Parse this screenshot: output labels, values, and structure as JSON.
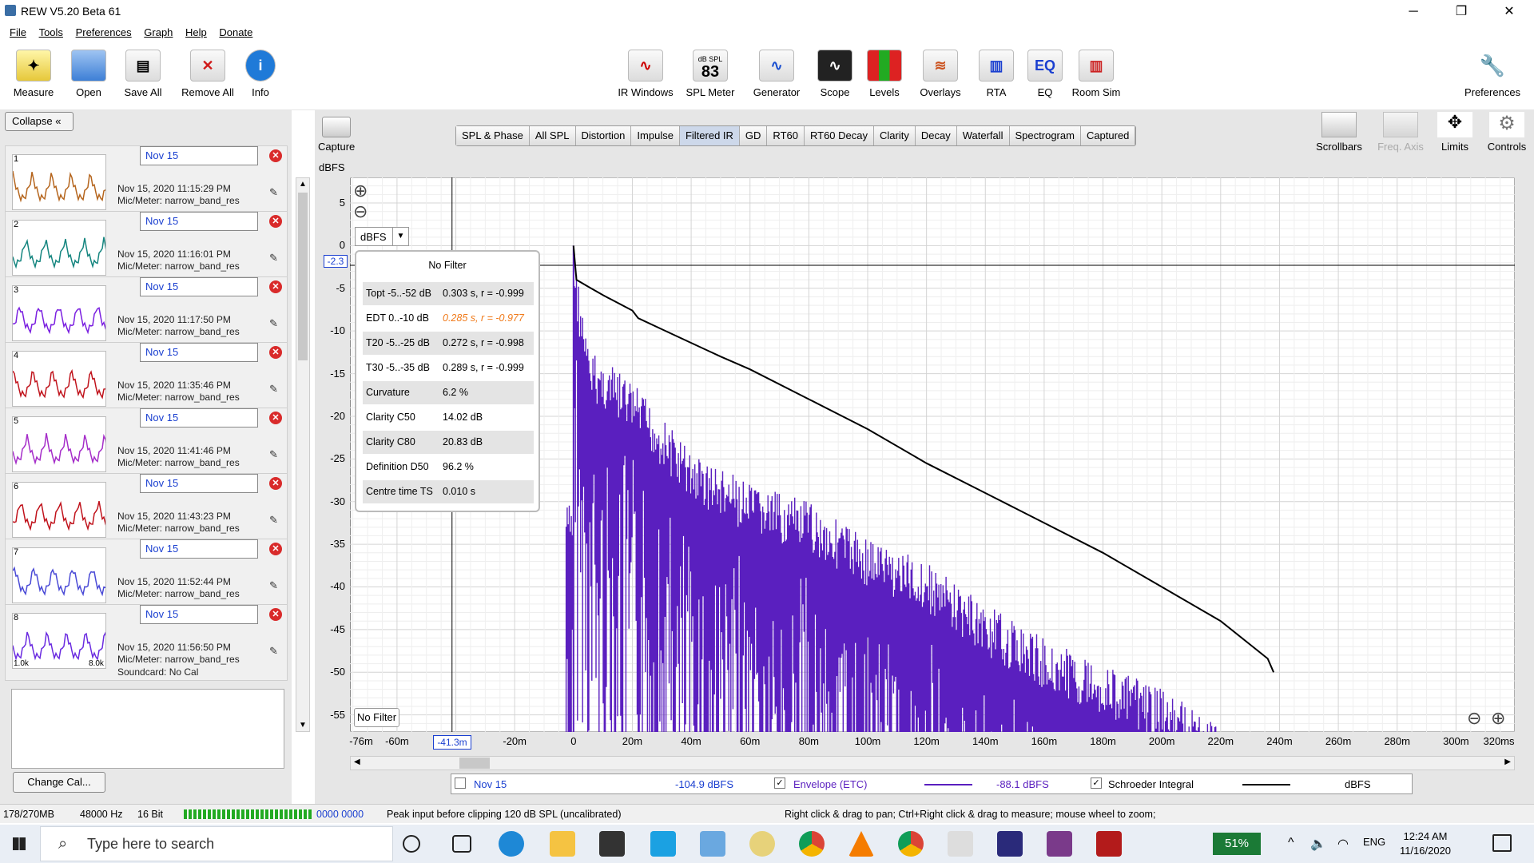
{
  "window": {
    "title": "REW V5.20 Beta 61",
    "minimize": "─",
    "restore": "❐",
    "close": "✕"
  },
  "menu": [
    "File",
    "Tools",
    "Preferences",
    "Graph",
    "Help",
    "Donate"
  ],
  "toolbar": {
    "left": [
      {
        "label": "Measure",
        "icon": "measure-icon"
      },
      {
        "label": "Open",
        "icon": "folder-icon"
      },
      {
        "label": "Save All",
        "icon": "save-icon"
      },
      {
        "label": "Remove All",
        "icon": "remove-all-icon"
      },
      {
        "label": "Info",
        "icon": "info-icon"
      }
    ],
    "center": [
      {
        "label": "IR Windows",
        "icon": "ir-windows-icon"
      },
      {
        "label": "SPL Meter",
        "icon": "spl-meter-icon",
        "badge_top": "dB SPL",
        "badge_value": "83"
      },
      {
        "label": "Generator",
        "icon": "generator-icon"
      },
      {
        "label": "Scope",
        "icon": "scope-icon"
      },
      {
        "label": "Levels",
        "icon": "levels-icon"
      },
      {
        "label": "Overlays",
        "icon": "overlays-icon"
      },
      {
        "label": "RTA",
        "icon": "rta-icon"
      },
      {
        "label": "EQ",
        "icon": "eq-icon"
      },
      {
        "label": "Room Sim",
        "icon": "room-sim-icon"
      }
    ],
    "preferences": "Preferences"
  },
  "left_panel": {
    "collapse": "Collapse",
    "change_cal": "Change Cal...",
    "measurements": [
      {
        "num": "1",
        "name": "Nov 15",
        "date": "Nov 15, 2020 11:15:29 PM",
        "mic": "Mic/Meter: narrow_band_res",
        "color": "#b5651d"
      },
      {
        "num": "2",
        "name": "Nov 15",
        "date": "Nov 15, 2020 11:16:01 PM",
        "mic": "Mic/Meter: narrow_band_res",
        "color": "#14857f"
      },
      {
        "num": "3",
        "name": "Nov 15",
        "date": "Nov 15, 2020 11:17:50 PM",
        "mic": "Mic/Meter: narrow_band_res",
        "color": "#7a1fe0"
      },
      {
        "num": "4",
        "name": "Nov 15",
        "date": "Nov 15, 2020 11:35:46 PM",
        "mic": "Mic/Meter: narrow_band_res",
        "color": "#c0121b"
      },
      {
        "num": "5",
        "name": "Nov 15",
        "date": "Nov 15, 2020 11:41:46 PM",
        "mic": "Mic/Meter: narrow_band_res",
        "color": "#a52dc9"
      },
      {
        "num": "6",
        "name": "Nov 15",
        "date": "Nov 15, 2020 11:43:23 PM",
        "mic": "Mic/Meter: narrow_band_res",
        "color": "#c0121b"
      },
      {
        "num": "7",
        "name": "Nov 15",
        "date": "Nov 15, 2020 11:52:44 PM",
        "mic": "Mic/Meter: narrow_band_res",
        "color": "#4a4ad6"
      },
      {
        "num": "8",
        "name": "Nov 15",
        "date": "Nov 15, 2020 11:56:50 PM",
        "mic": "Mic/Meter: narrow_band_res",
        "soundcard": "Soundcard: No Cal",
        "color": "#6a2ae0",
        "x_from": "1.0k",
        "x_to": "8.0k"
      }
    ]
  },
  "graph": {
    "capture": "Capture",
    "y_unit": "dBFS",
    "tabs": [
      "SPL & Phase",
      "All SPL",
      "Distortion",
      "Impulse",
      "Filtered IR",
      "GD",
      "RT60",
      "RT60 Decay",
      "Clarity",
      "Decay",
      "Waterfall",
      "Spectrogram",
      "Captured"
    ],
    "selected_tab": "Filtered IR",
    "right_tools": [
      "Scrollbars",
      "Freq. Axis",
      "Limits",
      "Controls"
    ],
    "dbfs_select": "dBFS",
    "cursor_y": "-2.3",
    "cursor_x": "-41.3m",
    "no_filter_button": "No Filter",
    "info": {
      "title": "No Filter",
      "rows": [
        {
          "k": "Topt -5..-52 dB",
          "v": "0.303 s,  r = -0.999",
          "hl": false
        },
        {
          "k": "EDT  0..-10 dB",
          "v": "0.285 s, r = -0.977",
          "hl": true
        },
        {
          "k": "T20 -5..-25 dB",
          "v": "0.272 s,  r = -0.998",
          "hl": false
        },
        {
          "k": "T30 -5..-35 dB",
          "v": "0.289 s,  r = -0.999",
          "hl": false
        },
        {
          "k": "Curvature",
          "v": "6.2 %",
          "hl": false
        },
        {
          "k": "Clarity C50",
          "v": "14.02 dB",
          "hl": false
        },
        {
          "k": "Clarity C80",
          "v": "20.83 dB",
          "hl": false
        },
        {
          "k": "Definition D50",
          "v": "96.2 %",
          "hl": false
        },
        {
          "k": "Centre time TS",
          "v": "0.010 s",
          "hl": false
        }
      ]
    },
    "legend": {
      "name": "Nov 15",
      "name_value": "-104.9 dBFS",
      "etc_label": "Envelope (ETC)",
      "etc_value": "-88.1 dBFS",
      "schroeder_label": "Schroeder Integral",
      "schroeder_value": "dBFS",
      "etc_color": "#5a1fbf",
      "schroeder_color": "#000000"
    }
  },
  "chart_data": {
    "type": "line",
    "xlabel": "",
    "ylabel": "dBFS",
    "xlim": [
      -76,
      320
    ],
    "ylim": [
      -57,
      8
    ],
    "x_ticks": [
      "-76m",
      "-60m",
      "-40m",
      "-20m",
      "0",
      "20m",
      "40m",
      "60m",
      "80m",
      "100m",
      "120m",
      "140m",
      "160m",
      "180m",
      "200m",
      "220m",
      "240m",
      "260m",
      "280m",
      "300m",
      "320ms"
    ],
    "y_ticks": [
      "5",
      "0",
      "-5",
      "-10",
      "-15",
      "-20",
      "-25",
      "-30",
      "-35",
      "-40",
      "-45",
      "-50",
      "-55"
    ],
    "series": [
      {
        "name": "Schroeder Integral",
        "x": [
          0,
          1,
          5,
          10,
          20,
          22,
          30,
          40,
          50,
          60,
          80,
          100,
          120,
          140,
          160,
          180,
          200,
          220,
          236,
          238
        ],
        "y": [
          0,
          -4,
          -4.8,
          -5.8,
          -7.6,
          -8.5,
          -9.8,
          -11.4,
          -13,
          -14.5,
          -18,
          -21.5,
          -25.5,
          -29,
          -32.5,
          -36,
          -40,
          -44,
          -48.4,
          -50
        ]
      },
      {
        "name": "Envelope (ETC)",
        "x": [
          0,
          5,
          20,
          40,
          60,
          80,
          100,
          120,
          140,
          160,
          180,
          200,
          220
        ],
        "y": [
          0,
          -12,
          -16,
          -24,
          -28,
          -30,
          -34,
          -37,
          -42,
          -46,
          -49,
          -52,
          -56
        ]
      }
    ]
  },
  "status": {
    "memory": "178/270MB",
    "rate": "48000 Hz",
    "bits": "16 Bit",
    "input_meter": "0000 0000",
    "peak": "Peak input before clipping 120 dB SPL (uncalibrated)",
    "hint": "Right click & drag to pan; Ctrl+Right click & drag to measure; mouse wheel to zoom;"
  },
  "taskbar": {
    "search": "Type here to search",
    "battery": "51%",
    "lang": "ENG",
    "time": "12:24 AM",
    "date": "11/16/2020"
  }
}
